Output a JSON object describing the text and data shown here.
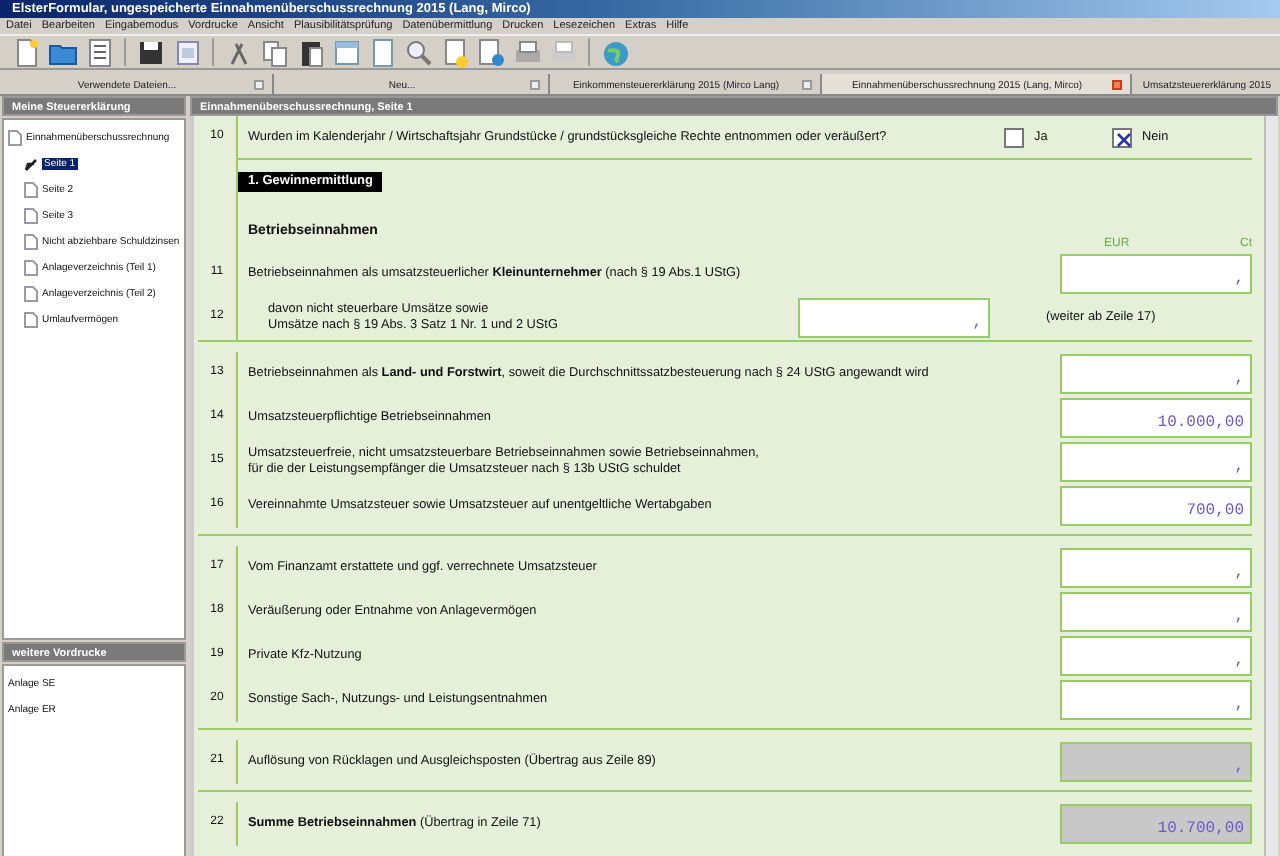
{
  "window": {
    "title": "ElsterFormular, ungespeicherte Einnahmenüberschussrechnung 2015 (Lang, Mirco)"
  },
  "menu": [
    "Datei",
    "Bearbeiten",
    "Eingabemodus",
    "Vordrucke",
    "Ansicht",
    "Plausibilitätsprüfung",
    "Datenübermittlung",
    "Drucken",
    "Lesezeichen",
    "Extras",
    "Hilfe"
  ],
  "doc_tabs": [
    {
      "label": "Verwendete Dateien...",
      "selected": false
    },
    {
      "label": "Neu...",
      "selected": false
    },
    {
      "label": "Einkommensteuererklärung 2015 (Mirco Lang)",
      "selected": false
    },
    {
      "label": "Einnahmenüberschussrechnung 2015 (Lang, Mirco)",
      "selected": true
    },
    {
      "label": "Umsatzsteuererklärung 2015",
      "selected": false
    }
  ],
  "sidebar": {
    "title": "Meine Steuererklärung",
    "tree": [
      {
        "label": "Einnahmenüberschussrechnung",
        "selected": false,
        "children": [
          {
            "label": "Seite 1",
            "selected": true
          },
          {
            "label": "Seite 2",
            "selected": false
          },
          {
            "label": "Seite 3",
            "selected": false
          },
          {
            "label": "Nicht abziehbare Schuldzinsen",
            "selected": false
          },
          {
            "label": "Anlageverzeichnis (Teil 1)",
            "selected": false
          },
          {
            "label": "Anlageverzeichnis (Teil 2)",
            "selected": false
          },
          {
            "label": "Umlaufvermögen",
            "selected": false
          }
        ]
      }
    ]
  },
  "more_forms": {
    "title": "weitere Vordrucke",
    "items": [
      "Anlage SE",
      "Anlage ER"
    ]
  },
  "form": {
    "title": "Einnahmenüberschussrechnung, Seite 1",
    "question": {
      "number": "10",
      "text": "Wurden im Kalenderjahr / Wirtschaftsjahr Grundstücke / grundstücksgleiche Rechte entnommen oder veräußert?",
      "options": [
        {
          "label": "Ja",
          "checked": false
        },
        {
          "label": "Nein",
          "checked": true
        }
      ]
    },
    "section": "1. Gewinnermittlung",
    "subheading": "Betriebseinnahmen",
    "columns": [
      "EUR",
      "Ct"
    ],
    "groups": [
      [
        {
          "number": "11",
          "kind": "field",
          "text": "Betriebseinnahmen als umsatzsteuerlicher **Kleinunternehmer** (nach § 19 Abs.1 UStG)",
          "value": ",",
          "readonly": false
        },
        {
          "number": "12",
          "kind": "inner",
          "text": "davon nicht steuerbare Umsätze sowie\nUmsätze nach § 19 Abs. 3 Satz 1 Nr. 1 und 2 UStG",
          "value": ",",
          "note": "(weiter ab Zeile 17)",
          "readonly": false
        }
      ],
      [
        {
          "number": "13",
          "kind": "field",
          "text": "Betriebseinnahmen als **Land- und Forstwirt**, soweit die Durchschnittssatzbesteuerung nach § 24 UStG angewandt wird",
          "value": ",",
          "readonly": false
        },
        {
          "number": "14",
          "kind": "field",
          "text": "Umsatzsteuerpflichtige Betriebseinnahmen",
          "value": "10.000,00",
          "readonly": false
        },
        {
          "number": "15",
          "kind": "field",
          "text": "Umsatzsteuerfreie, nicht umsatzsteuerbare Betriebseinnahmen sowie Betriebseinnahmen,\nfür die der Leistungsempfänger die Umsatzsteuer nach § 13b UStG schuldet",
          "value": ",",
          "readonly": false
        },
        {
          "number": "16",
          "kind": "field",
          "text": "Vereinnahmte Umsatzsteuer sowie Umsatzsteuer auf unentgeltliche Wertabgaben",
          "value": "700,00",
          "readonly": false
        }
      ],
      [
        {
          "number": "17",
          "kind": "field",
          "text": "Vom Finanzamt erstattete und ggf. verrechnete Umsatzsteuer",
          "value": ",",
          "readonly": false
        },
        {
          "number": "18",
          "kind": "field",
          "text": "Veräußerung oder Entnahme von Anlagevermögen",
          "value": ",",
          "readonly": false
        },
        {
          "number": "19",
          "kind": "field",
          "text": "Private Kfz-Nutzung",
          "value": ",",
          "readonly": false
        },
        {
          "number": "20",
          "kind": "field",
          "text": "Sonstige Sach-, Nutzungs- und Leistungsentnahmen",
          "value": ",",
          "readonly": false
        }
      ],
      [
        {
          "number": "21",
          "kind": "field",
          "text": "Auflösung von Rücklagen und Ausgleichsposten (Übertrag aus Zeile 89)",
          "value": ",",
          "readonly": true
        }
      ],
      [
        {
          "number": "22",
          "kind": "field",
          "text": "**Summe Betriebseinnahmen** (Übertrag in Zeile 71)",
          "value": "10.700,00",
          "readonly": true
        }
      ]
    ]
  }
}
